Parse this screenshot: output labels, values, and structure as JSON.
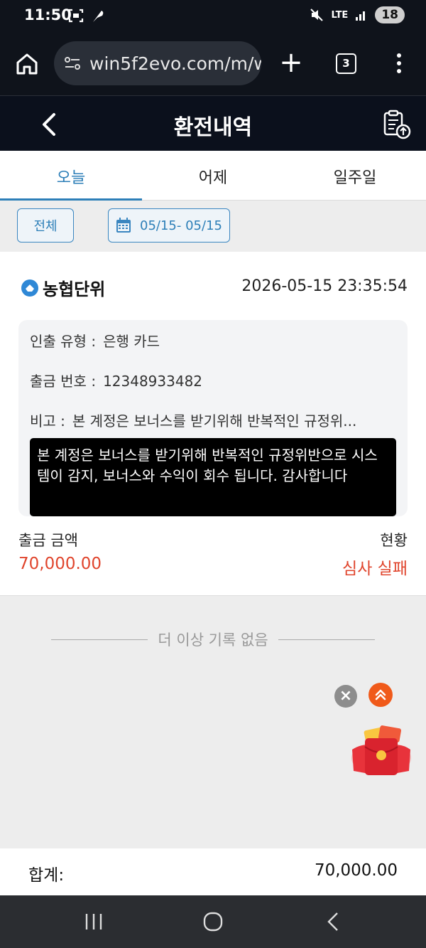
{
  "status_bar": {
    "time": "11:50",
    "network": "LTE",
    "battery": "18"
  },
  "browser": {
    "url": "win5f2evo.com/m/w",
    "tab_count": "3"
  },
  "header": {
    "title": "환전내역"
  },
  "day_tabs": [
    {
      "label": "오늘",
      "active": true
    },
    {
      "label": "어제",
      "active": false
    },
    {
      "label": "일주일",
      "active": false
    }
  ],
  "filters": {
    "all_label": "전체",
    "date_range": "05/15- 05/15"
  },
  "record": {
    "bank": "농협단위",
    "datetime": "2026-05-15 23:35:54",
    "withdraw_type_label": "인출 유형 :",
    "withdraw_type_value": "은행 카드",
    "withdraw_number_label": "출금 번호 :",
    "withdraw_number_value": "12348933482",
    "remark_label": "비고 :",
    "remark_value": "본 계정은 보너스를 받기위해 반복적인 규정위...",
    "tooltip": "본 계정은 보너스를 받기위해 반복적인 규정위반으로 시스템이 감지, 보너스와 수익이 회수 됩니다. 감사합니다",
    "amount_label": "출금 금액",
    "amount": "70,000.00",
    "status_label": "현황",
    "status_value": "심사 실패"
  },
  "list_end": "더 이상 기록 없음",
  "close_glyph": "×",
  "total": {
    "label": "합계:",
    "value": "70,000.00"
  },
  "colors": {
    "accent": "#2d7fb8",
    "danger": "#e0452d",
    "header_bg": "#0b101c"
  }
}
